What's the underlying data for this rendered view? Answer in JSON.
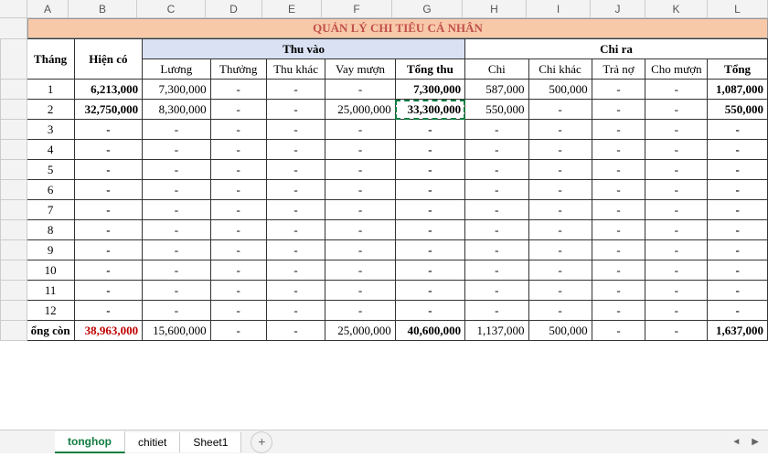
{
  "columns": [
    "A",
    "B",
    "C",
    "D",
    "E",
    "F",
    "G",
    "H",
    "I",
    "J",
    "K",
    "L"
  ],
  "title": "QUẢN LÝ CHI TIÊU CÁ NHÂN",
  "headers": {
    "thang": "Tháng",
    "hienco": "Hiện có",
    "thuvao": "Thu vào",
    "chira": "Chi ra",
    "luong": "Lương",
    "thuong": "Thưởng",
    "thukhac": "Thu khác",
    "vaymuon": "Vay mượn",
    "tongthu": "Tổng thu",
    "chi": "Chi",
    "chikhac": "Chi khác",
    "trano": "Trả nợ",
    "chomuon": "Cho mượn",
    "tong": "Tổng"
  },
  "rows": [
    {
      "m": "1",
      "hc": "6,213,000",
      "l": "7,300,000",
      "t": "-",
      "tk": "-",
      "v": "-",
      "tt": "7,300,000",
      "c": "587,000",
      "ck": "500,000",
      "tn": "-",
      "cm": "-",
      "tg": "1,087,000"
    },
    {
      "m": "2",
      "hc": "32,750,000",
      "l": "8,300,000",
      "t": "-",
      "tk": "-",
      "v": "25,000,000",
      "tt": "33,300,000",
      "c": "550,000",
      "ck": "-",
      "tn": "-",
      "cm": "-",
      "tg": "550,000"
    },
    {
      "m": "3",
      "hc": "-",
      "l": "-",
      "t": "-",
      "tk": "-",
      "v": "-",
      "tt": "-",
      "c": "-",
      "ck": "-",
      "tn": "-",
      "cm": "-",
      "tg": "-"
    },
    {
      "m": "4",
      "hc": "-",
      "l": "-",
      "t": "-",
      "tk": "-",
      "v": "-",
      "tt": "-",
      "c": "-",
      "ck": "-",
      "tn": "-",
      "cm": "-",
      "tg": "-"
    },
    {
      "m": "5",
      "hc": "-",
      "l": "-",
      "t": "-",
      "tk": "-",
      "v": "-",
      "tt": "-",
      "c": "-",
      "ck": "-",
      "tn": "-",
      "cm": "-",
      "tg": "-"
    },
    {
      "m": "6",
      "hc": "-",
      "l": "-",
      "t": "-",
      "tk": "-",
      "v": "-",
      "tt": "-",
      "c": "-",
      "ck": "-",
      "tn": "-",
      "cm": "-",
      "tg": "-"
    },
    {
      "m": "7",
      "hc": "-",
      "l": "-",
      "t": "-",
      "tk": "-",
      "v": "-",
      "tt": "-",
      "c": "-",
      "ck": "-",
      "tn": "-",
      "cm": "-",
      "tg": "-"
    },
    {
      "m": "8",
      "hc": "-",
      "l": "-",
      "t": "-",
      "tk": "-",
      "v": "-",
      "tt": "-",
      "c": "-",
      "ck": "-",
      "tn": "-",
      "cm": "-",
      "tg": "-"
    },
    {
      "m": "9",
      "hc": "-",
      "l": "-",
      "t": "-",
      "tk": "-",
      "v": "-",
      "tt": "-",
      "c": "-",
      "ck": "-",
      "tn": "-",
      "cm": "-",
      "tg": "-"
    },
    {
      "m": "10",
      "hc": "-",
      "l": "-",
      "t": "-",
      "tk": "-",
      "v": "-",
      "tt": "-",
      "c": "-",
      "ck": "-",
      "tn": "-",
      "cm": "-",
      "tg": "-"
    },
    {
      "m": "11",
      "hc": "-",
      "l": "-",
      "t": "-",
      "tk": "-",
      "v": "-",
      "tt": "-",
      "c": "-",
      "ck": "-",
      "tn": "-",
      "cm": "-",
      "tg": "-"
    },
    {
      "m": "12",
      "hc": "-",
      "l": "-",
      "t": "-",
      "tk": "-",
      "v": "-",
      "tt": "-",
      "c": "-",
      "ck": "-",
      "tn": "-",
      "cm": "-",
      "tg": "-"
    }
  ],
  "total": {
    "label": "ổng còn",
    "hc": "38,963,000",
    "l": "15,600,000",
    "t": "-",
    "tk": "-",
    "v": "25,000,000",
    "tt": "40,600,000",
    "c": "1,137,000",
    "ck": "500,000",
    "tn": "-",
    "cm": "-",
    "tg": "1,637,000"
  },
  "tabs": {
    "active": "tonghop",
    "t2": "chitiet",
    "t3": "Sheet1"
  },
  "scroll": {
    "left": "◄",
    "right": "▶"
  }
}
